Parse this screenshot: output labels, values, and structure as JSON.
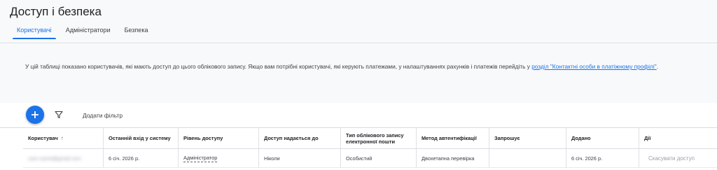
{
  "page": {
    "title": "Доступ і безпека"
  },
  "tabs": [
    {
      "label": "Користувачі",
      "active": true
    },
    {
      "label": "Адміністратори",
      "active": false
    },
    {
      "label": "Безпека",
      "active": false
    }
  ],
  "info": {
    "text": "У цій таблиці показано користувачів, які мають доступ до цього облікового запису. Якщо вам потрібні користувачі, які керують платежами, у налаштуваннях рахунків і платежів перейдіть у ",
    "link": "розділ \"Контактні особи в платіжному профілі\"",
    "suffix": "."
  },
  "toolbar": {
    "add_icon": "plus-icon",
    "filter_icon": "filter-icon",
    "add_filter_label": "Додати фільтр"
  },
  "table": {
    "columns": [
      "Користувач",
      "Останній вхід у систему",
      "Рівень доступу",
      "Доступ надається до",
      "Тип облікового запису електронної пошти",
      "Метод автентифікації",
      "Запрошує",
      "Додано",
      "Дії"
    ],
    "sort_indicator": "↑",
    "rows": [
      {
        "user": "user.name@gmail.com",
        "last_login": "6 січ. 2026 р.",
        "access_level": "Адміністратор",
        "access_to": "Ніколи",
        "email_type": "Особистий",
        "auth_method": "Двохетапна перевірка",
        "invited_by": "",
        "added": "6 січ. 2026 р.",
        "action": "Скасувати доступ"
      }
    ]
  },
  "colors": {
    "accent": "#1a73e8",
    "header_bg": "#f8f9fa"
  }
}
